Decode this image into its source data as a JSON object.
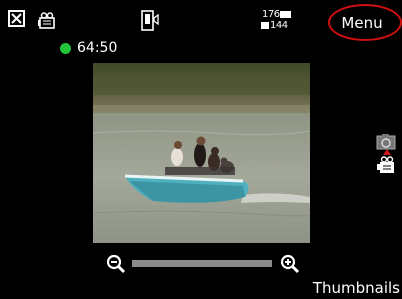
{
  "softkeys": {
    "menu_label": "Menu",
    "thumbnails_label": "Thumbnails"
  },
  "recording": {
    "time_remaining": "64:50",
    "status_color": "#22c43a"
  },
  "resolution": {
    "top": "176",
    "bottom": "144"
  },
  "zoom": {
    "level": 0
  },
  "highlight_color": "#d01010",
  "icons": [
    "close-icon",
    "camcorder-icon",
    "device-icon",
    "resolution-icon",
    "camera-icon",
    "zoom-out-icon",
    "zoom-in-icon"
  ]
}
